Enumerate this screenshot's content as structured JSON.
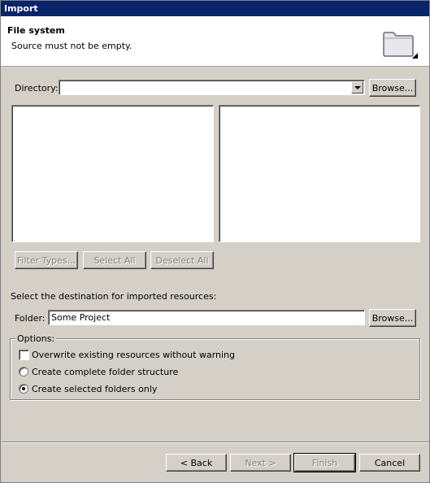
{
  "window": {
    "title": "Import"
  },
  "header": {
    "title": "File system",
    "message": "Source must not be empty."
  },
  "icons": {
    "header": "folder-icon",
    "combo": "chevron-down-icon"
  },
  "source": {
    "directory_label": "Directory:",
    "directory_value": "",
    "browse_label": "Browse...",
    "filter_types_label": "Filter Types...",
    "select_all_label": "Select All",
    "deselect_all_label": "Deselect All"
  },
  "destination": {
    "prompt": "Select the destination for imported resources:",
    "folder_label": "Folder:",
    "folder_value": "Some Project",
    "browse_label": "Browse..."
  },
  "options": {
    "legend": "Options:",
    "overwrite_label": "Overwrite existing resources without warning",
    "overwrite_checked": false,
    "create_complete_label": "Create complete folder structure",
    "create_selected_label": "Create selected folders only",
    "selected_option": "create_selected"
  },
  "footer": {
    "back_label": "< Back",
    "next_label": "Next >",
    "finish_label": "Finish",
    "cancel_label": "Cancel"
  },
  "colors": {
    "titlebar": "#0a246a",
    "dialog_bg": "#d4d0c8",
    "header_bg": "#ffffff"
  }
}
